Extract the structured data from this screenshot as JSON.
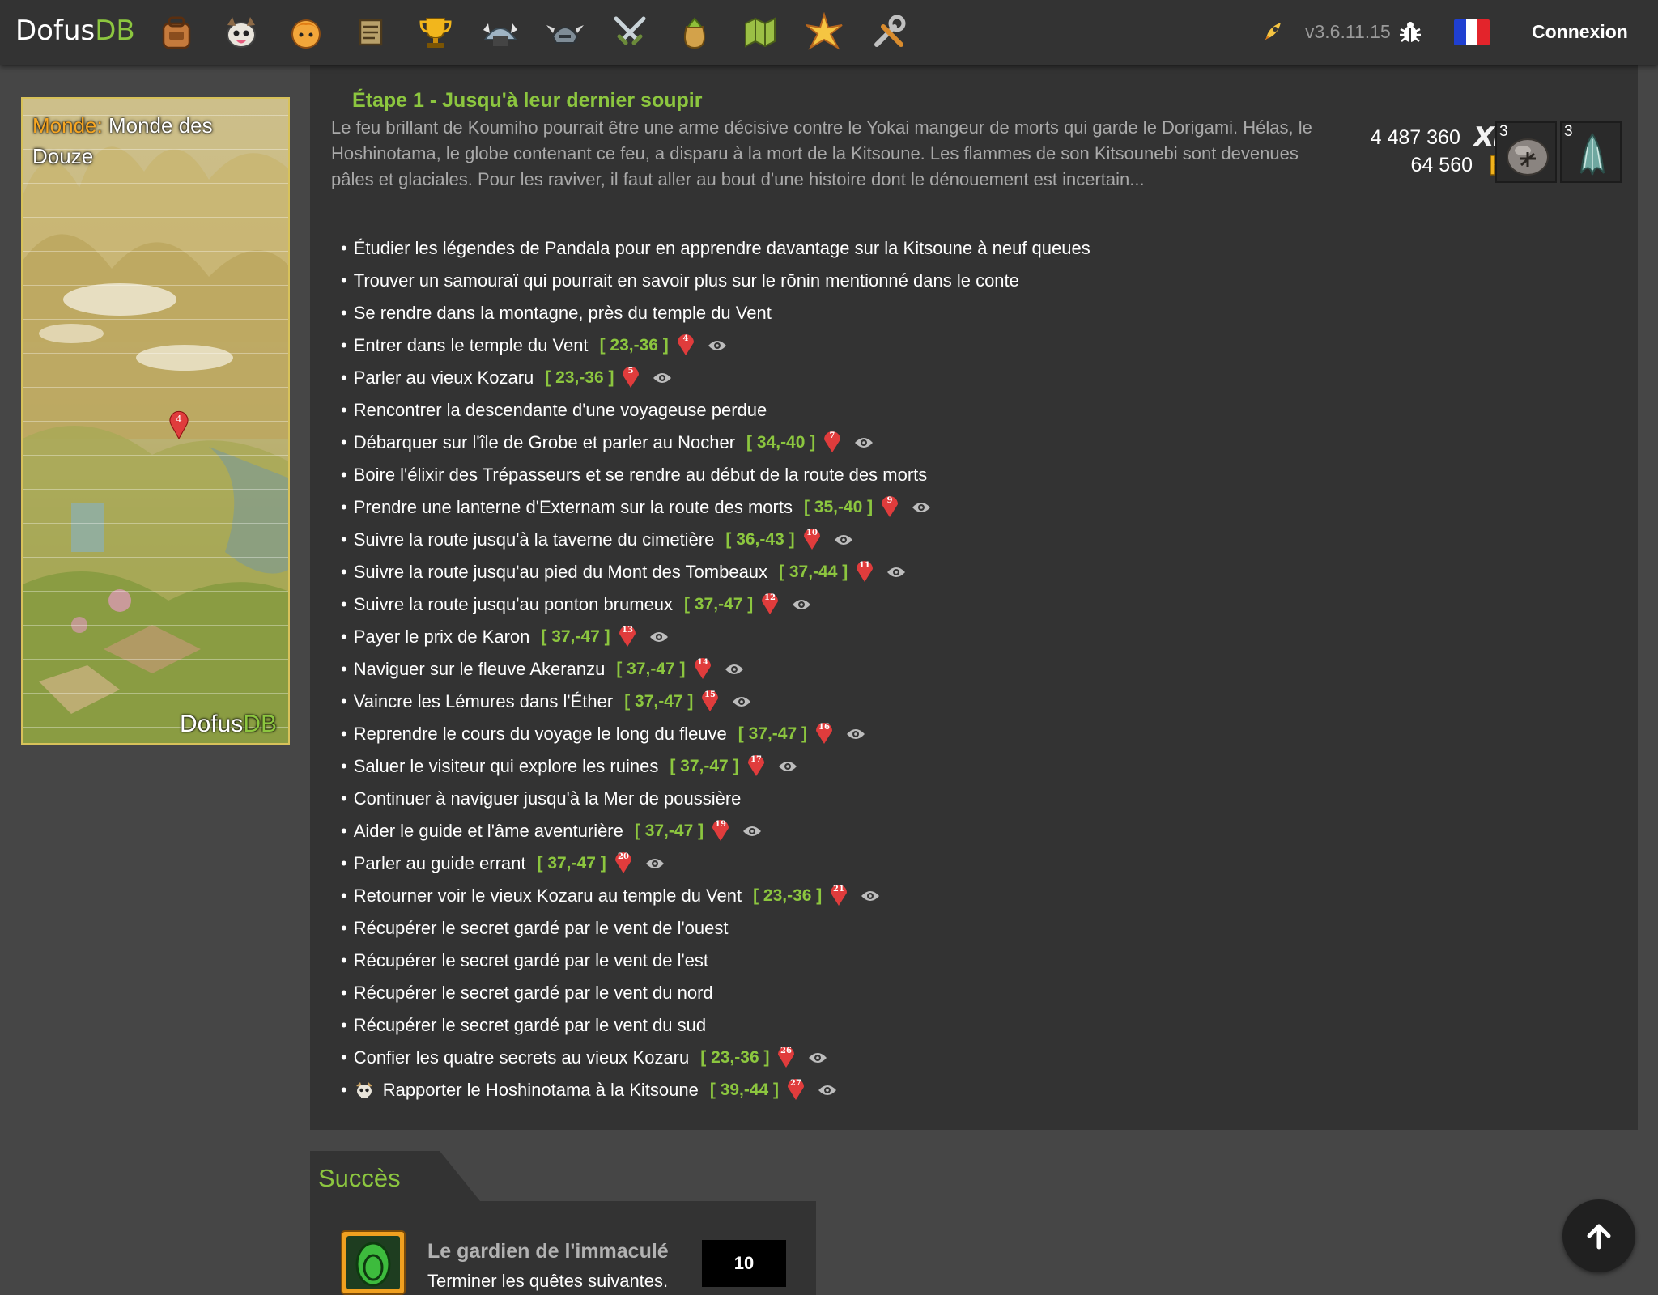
{
  "header": {
    "brand_main": "Dofus",
    "brand_accent": "DB",
    "nav_icons": [
      "bag-icon",
      "monster-icon",
      "character-icon",
      "scroll-icon",
      "trophy-icon",
      "dungeon-icon",
      "helmet-icon",
      "swords-icon",
      "resource-bag-icon",
      "map-icon",
      "star-burst-icon",
      "tools-icon"
    ],
    "version": "v3.6.11.15",
    "login": "Connexion",
    "flag_colors": [
      "#1f3fd1",
      "#ffffff",
      "#e3242b"
    ]
  },
  "map": {
    "world_label": "Monde:",
    "world_name": "Monde des Douze",
    "watermark_main": "Dofus",
    "watermark_accent": "DB",
    "pin_number": "4"
  },
  "quest": {
    "title": "Étape 1 - Jusqu'à leur dernier soupir",
    "description": "Le feu brillant de Koumiho pourrait être une arme décisive contre le Yokai mangeur de morts qui garde le Dorigami. Hélas, le Hoshinotama, le globe contenant ce feu, a disparu à la mort de la Kitsoune. Les flammes de son Kitsounebi sont devenues pâles et glaciales. Pour les raviver, il faut aller au bout d'une histoire dont le dénouement est incertain...",
    "xp": "4 487 360",
    "xp_icon": "XP",
    "kamas": "64 560",
    "items": [
      {
        "qty": "3",
        "icon": "yokai-stone-icon"
      },
      {
        "qty": "3",
        "icon": "spirit-tail-icon"
      }
    ],
    "steps": [
      {
        "text": "Étudier les légendes de Pandala pour en apprendre davantage sur la Kitsoune à neuf queues"
      },
      {
        "text": "Trouver un samouraï qui pourrait en savoir plus sur le rōnin mentionné dans le conte"
      },
      {
        "text": "Se rendre dans la montagne, près du temple du Vent"
      },
      {
        "text": "Entrer dans le temple du Vent",
        "coord": "[ 23,-36 ]",
        "pin": "4"
      },
      {
        "text": "Parler au vieux Kozaru",
        "coord": "[ 23,-36 ]",
        "pin": "5"
      },
      {
        "text": "Rencontrer la descendante d'une voyageuse perdue"
      },
      {
        "text": "Débarquer sur l'île de Grobe et parler au Nocher",
        "coord": "[ 34,-40 ]",
        "pin": "7"
      },
      {
        "text": "Boire l'élixir des Trépasseurs et se rendre au début de la route des morts"
      },
      {
        "text": "Prendre une lanterne d'Externam sur la route des morts",
        "coord": "[ 35,-40 ]",
        "pin": "9"
      },
      {
        "text": "Suivre la route jusqu'à la taverne du cimetière",
        "coord": "[ 36,-43 ]",
        "pin": "10"
      },
      {
        "text": "Suivre la route jusqu'au pied du Mont des Tombeaux",
        "coord": "[ 37,-44 ]",
        "pin": "11"
      },
      {
        "text": "Suivre la route jusqu'au ponton brumeux",
        "coord": "[ 37,-47 ]",
        "pin": "12"
      },
      {
        "text": "Payer le prix de Karon",
        "coord": "[ 37,-47 ]",
        "pin": "13"
      },
      {
        "text": "Naviguer sur le fleuve Akeranzu",
        "coord": "[ 37,-47 ]",
        "pin": "14"
      },
      {
        "text": "Vaincre les Lémures dans l'Éther",
        "coord": "[ 37,-47 ]",
        "pin": "15"
      },
      {
        "text": "Reprendre le cours du voyage le long du fleuve",
        "coord": "[ 37,-47 ]",
        "pin": "16"
      },
      {
        "text": "Saluer le visiteur qui explore les ruines",
        "coord": "[ 37,-47 ]",
        "pin": "17"
      },
      {
        "text": "Continuer à naviguer jusqu'à la Mer de poussière"
      },
      {
        "text": "Aider le guide et l'âme aventurière",
        "coord": "[ 37,-47 ]",
        "pin": "19"
      },
      {
        "text": "Parler au guide errant",
        "coord": "[ 37,-47 ]",
        "pin": "20"
      },
      {
        "text": "Retourner voir le vieux Kozaru au temple du Vent",
        "coord": "[ 23,-36 ]",
        "pin": "21"
      },
      {
        "text": "Récupérer le secret gardé par le vent de l'ouest"
      },
      {
        "text": "Récupérer le secret gardé par le vent de l'est"
      },
      {
        "text": "Récupérer le secret gardé par le vent du nord"
      },
      {
        "text": "Récupérer le secret gardé par le vent du sud"
      },
      {
        "text": "Confier les quatre secrets au vieux Kozaru",
        "coord": "[ 23,-36 ]",
        "pin": "26"
      },
      {
        "text": "Rapporter le Hoshinotama à la Kitsoune",
        "coord": "[ 39,-44 ]",
        "pin": "27",
        "skull": true
      }
    ]
  },
  "success": {
    "section_title": "Succès",
    "name": "Le gardien de l'immaculé",
    "subtitle": "Terminer les quêtes suivantes.",
    "points": "10"
  },
  "colors": {
    "accent_green": "#8cc63f",
    "pin_red": "#e03c3c",
    "panel": "#333333",
    "background": "#464646"
  }
}
